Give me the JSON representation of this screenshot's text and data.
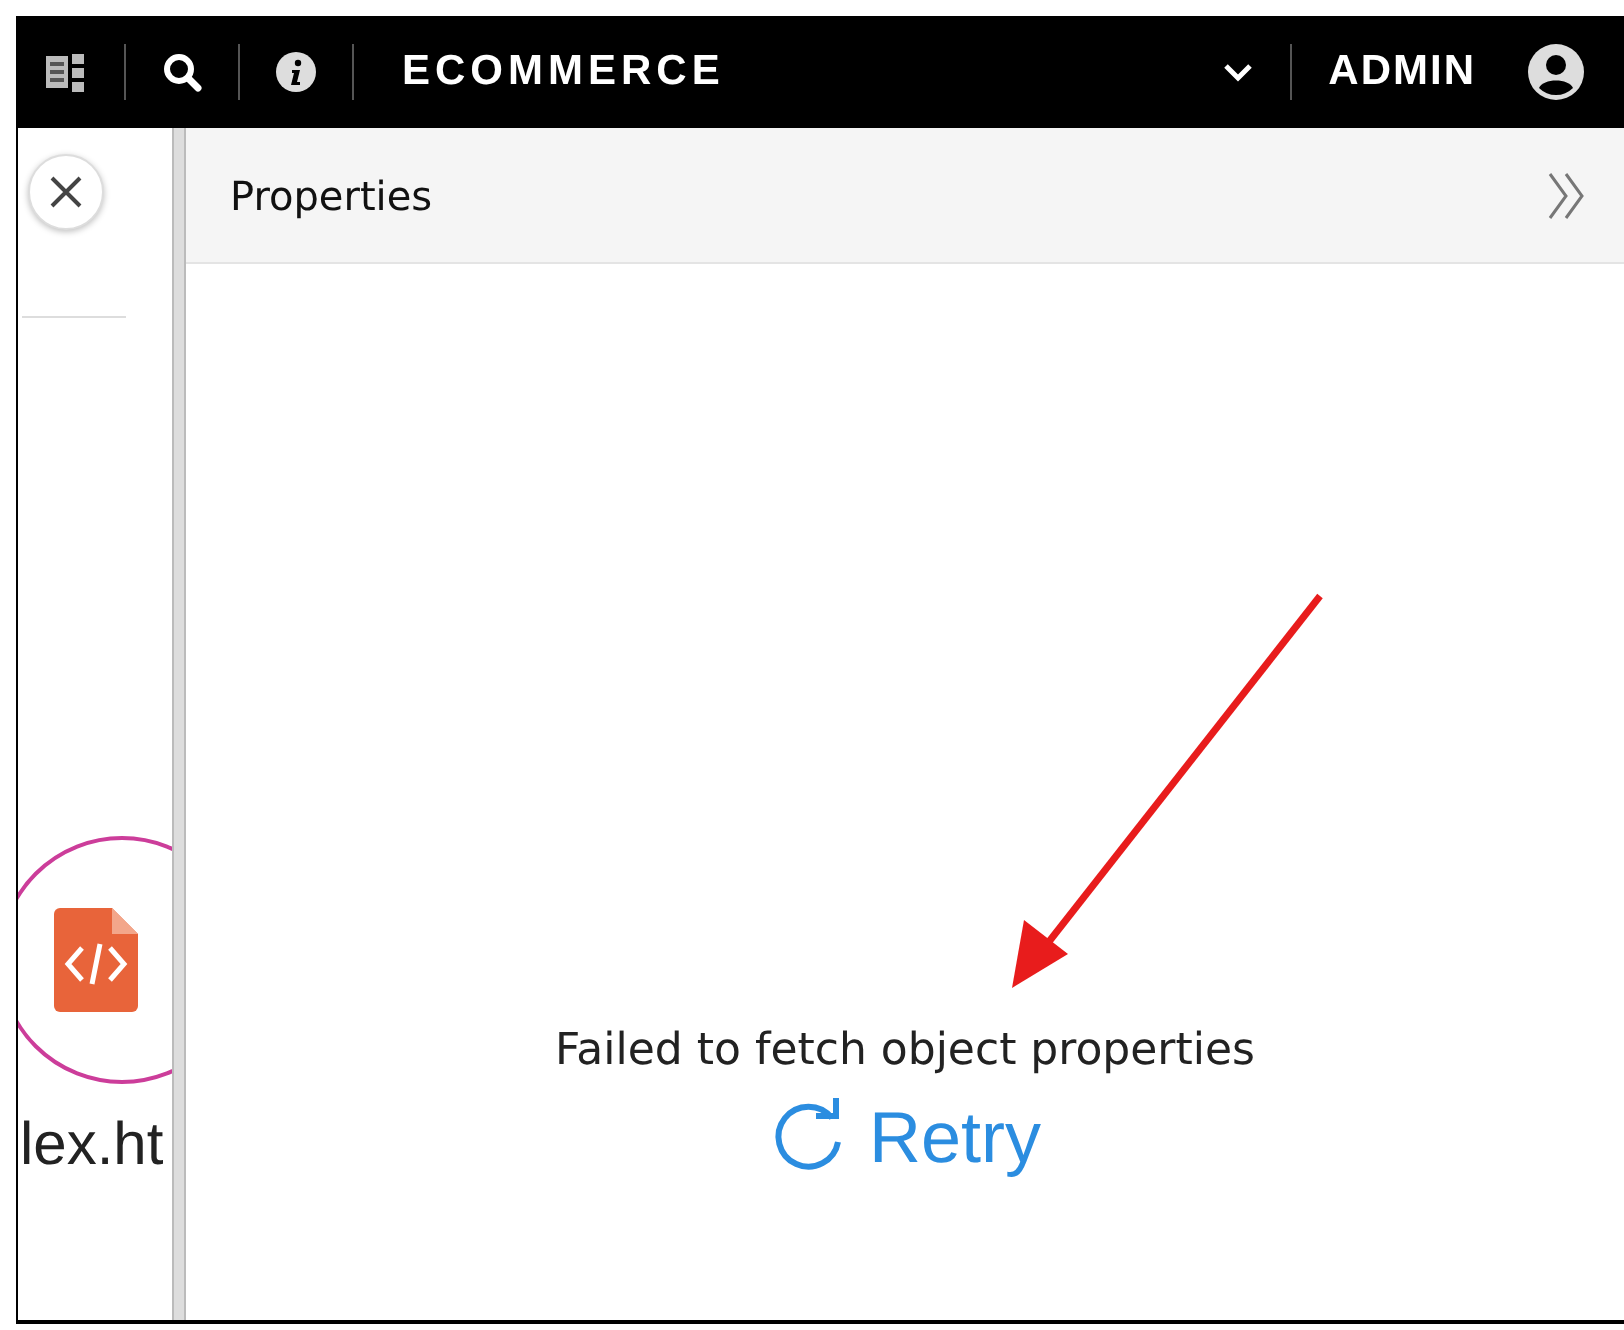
{
  "top_bar": {
    "app_name": "ECOMMERCE",
    "user": "ADMIN"
  },
  "left_panel": {
    "file_name": "lex.ht"
  },
  "properties_panel": {
    "title": "Properties",
    "message": "Failed to fetch object properties",
    "retry": "Retry"
  }
}
